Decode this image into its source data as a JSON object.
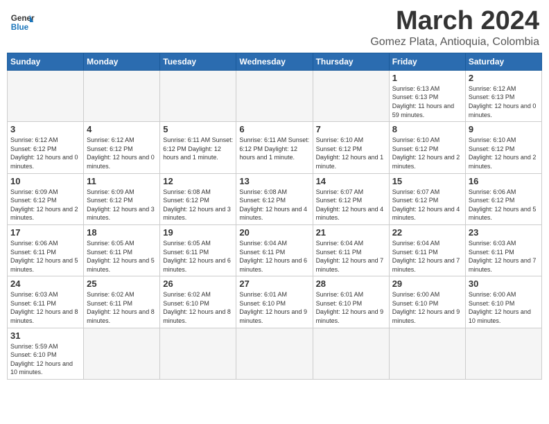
{
  "logo": {
    "general": "General",
    "blue": "Blue"
  },
  "title": "March 2024",
  "subtitle": "Gomez Plata, Antioquia, Colombia",
  "days_of_week": [
    "Sunday",
    "Monday",
    "Tuesday",
    "Wednesday",
    "Thursday",
    "Friday",
    "Saturday"
  ],
  "weeks": [
    [
      {
        "day": "",
        "info": "",
        "empty": true
      },
      {
        "day": "",
        "info": "",
        "empty": true
      },
      {
        "day": "",
        "info": "",
        "empty": true
      },
      {
        "day": "",
        "info": "",
        "empty": true
      },
      {
        "day": "",
        "info": "",
        "empty": true
      },
      {
        "day": "1",
        "info": "Sunrise: 6:13 AM\nSunset: 6:13 PM\nDaylight: 11 hours and 59 minutes.",
        "empty": false
      },
      {
        "day": "2",
        "info": "Sunrise: 6:12 AM\nSunset: 6:13 PM\nDaylight: 12 hours and 0 minutes.",
        "empty": false
      }
    ],
    [
      {
        "day": "3",
        "info": "Sunrise: 6:12 AM\nSunset: 6:12 PM\nDaylight: 12 hours and 0 minutes.",
        "empty": false
      },
      {
        "day": "4",
        "info": "Sunrise: 6:12 AM\nSunset: 6:12 PM\nDaylight: 12 hours and 0 minutes.",
        "empty": false
      },
      {
        "day": "5",
        "info": "Sunrise: 6:11 AM\nSunset: 6:12 PM\nDaylight: 12 hours and 1 minute.",
        "empty": false
      },
      {
        "day": "6",
        "info": "Sunrise: 6:11 AM\nSunset: 6:12 PM\nDaylight: 12 hours and 1 minute.",
        "empty": false
      },
      {
        "day": "7",
        "info": "Sunrise: 6:10 AM\nSunset: 6:12 PM\nDaylight: 12 hours and 1 minute.",
        "empty": false
      },
      {
        "day": "8",
        "info": "Sunrise: 6:10 AM\nSunset: 6:12 PM\nDaylight: 12 hours and 2 minutes.",
        "empty": false
      },
      {
        "day": "9",
        "info": "Sunrise: 6:10 AM\nSunset: 6:12 PM\nDaylight: 12 hours and 2 minutes.",
        "empty": false
      }
    ],
    [
      {
        "day": "10",
        "info": "Sunrise: 6:09 AM\nSunset: 6:12 PM\nDaylight: 12 hours and 2 minutes.",
        "empty": false
      },
      {
        "day": "11",
        "info": "Sunrise: 6:09 AM\nSunset: 6:12 PM\nDaylight: 12 hours and 3 minutes.",
        "empty": false
      },
      {
        "day": "12",
        "info": "Sunrise: 6:08 AM\nSunset: 6:12 PM\nDaylight: 12 hours and 3 minutes.",
        "empty": false
      },
      {
        "day": "13",
        "info": "Sunrise: 6:08 AM\nSunset: 6:12 PM\nDaylight: 12 hours and 4 minutes.",
        "empty": false
      },
      {
        "day": "14",
        "info": "Sunrise: 6:07 AM\nSunset: 6:12 PM\nDaylight: 12 hours and 4 minutes.",
        "empty": false
      },
      {
        "day": "15",
        "info": "Sunrise: 6:07 AM\nSunset: 6:12 PM\nDaylight: 12 hours and 4 minutes.",
        "empty": false
      },
      {
        "day": "16",
        "info": "Sunrise: 6:06 AM\nSunset: 6:12 PM\nDaylight: 12 hours and 5 minutes.",
        "empty": false
      }
    ],
    [
      {
        "day": "17",
        "info": "Sunrise: 6:06 AM\nSunset: 6:11 PM\nDaylight: 12 hours and 5 minutes.",
        "empty": false
      },
      {
        "day": "18",
        "info": "Sunrise: 6:05 AM\nSunset: 6:11 PM\nDaylight: 12 hours and 5 minutes.",
        "empty": false
      },
      {
        "day": "19",
        "info": "Sunrise: 6:05 AM\nSunset: 6:11 PM\nDaylight: 12 hours and 6 minutes.",
        "empty": false
      },
      {
        "day": "20",
        "info": "Sunrise: 6:04 AM\nSunset: 6:11 PM\nDaylight: 12 hours and 6 minutes.",
        "empty": false
      },
      {
        "day": "21",
        "info": "Sunrise: 6:04 AM\nSunset: 6:11 PM\nDaylight: 12 hours and 7 minutes.",
        "empty": false
      },
      {
        "day": "22",
        "info": "Sunrise: 6:04 AM\nSunset: 6:11 PM\nDaylight: 12 hours and 7 minutes.",
        "empty": false
      },
      {
        "day": "23",
        "info": "Sunrise: 6:03 AM\nSunset: 6:11 PM\nDaylight: 12 hours and 7 minutes.",
        "empty": false
      }
    ],
    [
      {
        "day": "24",
        "info": "Sunrise: 6:03 AM\nSunset: 6:11 PM\nDaylight: 12 hours and 8 minutes.",
        "empty": false
      },
      {
        "day": "25",
        "info": "Sunrise: 6:02 AM\nSunset: 6:11 PM\nDaylight: 12 hours and 8 minutes.",
        "empty": false
      },
      {
        "day": "26",
        "info": "Sunrise: 6:02 AM\nSunset: 6:10 PM\nDaylight: 12 hours and 8 minutes.",
        "empty": false
      },
      {
        "day": "27",
        "info": "Sunrise: 6:01 AM\nSunset: 6:10 PM\nDaylight: 12 hours and 9 minutes.",
        "empty": false
      },
      {
        "day": "28",
        "info": "Sunrise: 6:01 AM\nSunset: 6:10 PM\nDaylight: 12 hours and 9 minutes.",
        "empty": false
      },
      {
        "day": "29",
        "info": "Sunrise: 6:00 AM\nSunset: 6:10 PM\nDaylight: 12 hours and 9 minutes.",
        "empty": false
      },
      {
        "day": "30",
        "info": "Sunrise: 6:00 AM\nSunset: 6:10 PM\nDaylight: 12 hours and 10 minutes.",
        "empty": false
      }
    ],
    [
      {
        "day": "31",
        "info": "Sunrise: 5:59 AM\nSunset: 6:10 PM\nDaylight: 12 hours and 10 minutes.",
        "empty": false
      },
      {
        "day": "",
        "info": "",
        "empty": true
      },
      {
        "day": "",
        "info": "",
        "empty": true
      },
      {
        "day": "",
        "info": "",
        "empty": true
      },
      {
        "day": "",
        "info": "",
        "empty": true
      },
      {
        "day": "",
        "info": "",
        "empty": true
      },
      {
        "day": "",
        "info": "",
        "empty": true
      }
    ]
  ]
}
